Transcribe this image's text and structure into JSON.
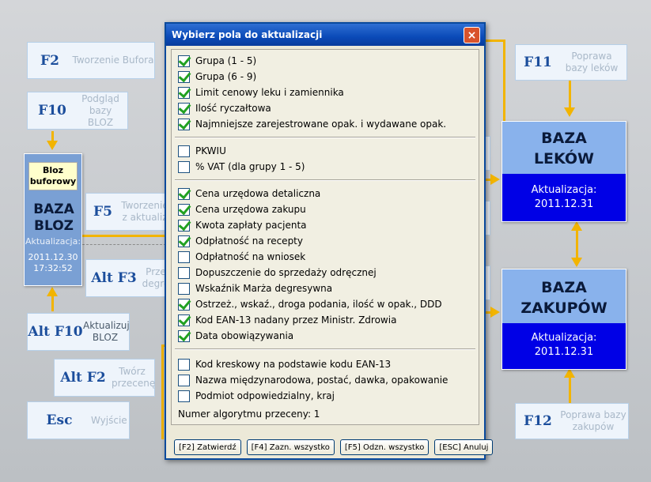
{
  "left_keys": [
    {
      "key": "F2",
      "desc": "Tworzenie Bufora"
    },
    {
      "key": "F10",
      "desc": "Podgląd bazy BLOZ"
    },
    {
      "key": "F5",
      "desc": "Tworzenie z aktualiz"
    },
    {
      "key": "Alt F3",
      "desc": "Prze degre"
    },
    {
      "key": "Alt F10",
      "desc": "Aktualizuj BLOZ"
    },
    {
      "key": "Alt F2",
      "desc": "Twórz przecenę"
    },
    {
      "key": "Esc",
      "desc": "Wyjście"
    }
  ],
  "right_keys": [
    {
      "key": "F11",
      "desc": "Poprawa bazy leków"
    },
    {
      "key": "F12",
      "desc": "Poprawa bazy zakupów"
    }
  ],
  "bloz": {
    "buffer_label": "Bloz buforowy",
    "title": "BAZA BLOZ",
    "update_label": "Aktualizacja:",
    "update_date": "2011.12.30",
    "update_time": "17:32:52"
  },
  "baza_lekow": {
    "title": "BAZA LEKÓW",
    "update_label": "Aktualizacja:",
    "update_date": "2011.12.31"
  },
  "baza_zakupow": {
    "title": "BAZA ZAKUPÓW",
    "update_label": "Aktualizacja:",
    "update_date": "2011.12.31"
  },
  "dialog": {
    "title": "Wybierz pola do aktualizacji",
    "close_glyph": "×",
    "groups": [
      {
        "items": [
          {
            "label": "Grupa (1 - 5)",
            "checked": true
          },
          {
            "label": "Grupa (6 - 9)",
            "checked": true
          },
          {
            "label": "Limit cenowy leku i zamiennika",
            "checked": true
          },
          {
            "label": "Ilość ryczałtowa",
            "checked": true
          },
          {
            "label": "Najmniejsze zarejestrowane opak. i wydawane opak.",
            "checked": true
          }
        ]
      },
      {
        "items": [
          {
            "label": "PKWIU",
            "checked": false
          },
          {
            "label": "% VAT (dla grupy 1 - 5)",
            "checked": false
          }
        ]
      },
      {
        "items": [
          {
            "label": "Cena urzędowa detaliczna",
            "checked": true
          },
          {
            "label": "Cena urzędowa zakupu",
            "checked": true
          },
          {
            "label": "Kwota zapłaty pacjenta",
            "checked": true
          },
          {
            "label": "Odpłatność na recepty",
            "checked": true
          },
          {
            "label": "Odpłatność na wniosek",
            "checked": false
          },
          {
            "label": "Dopuszczenie do sprzedaży odręcznej",
            "checked": false
          },
          {
            "label": "Wskaźnik Marża degresywna",
            "checked": false
          },
          {
            "label": "Ostrzeż., wskaź., droga podania, ilość w opak., DDD",
            "checked": true
          },
          {
            "label": "Kod EAN-13 nadany przez Ministr. Zdrowia",
            "checked": true
          },
          {
            "label": "Data obowiązywania",
            "checked": true
          }
        ]
      },
      {
        "items": [
          {
            "label": "Kod kreskowy na podstawie kodu EAN-13",
            "checked": false
          },
          {
            "label": "Nazwa międzynarodowa, postać, dawka, opakowanie",
            "checked": false
          },
          {
            "label": "Podmiot odpowiedzialny, kraj",
            "checked": false
          }
        ]
      }
    ],
    "algorithm_text": "Numer algorytmu przeceny: 1",
    "buttons": [
      "[F2] Zatwierdź",
      "[F4] Zazn. wszystko",
      "[F5] Odzn. wszystko",
      "[ESC] Anuluj"
    ]
  },
  "colors": {
    "accent_line": "#f2b400",
    "check": "#21a121",
    "baza_update_bg": "#0000e6",
    "titlebar": "#0a4ab8"
  }
}
